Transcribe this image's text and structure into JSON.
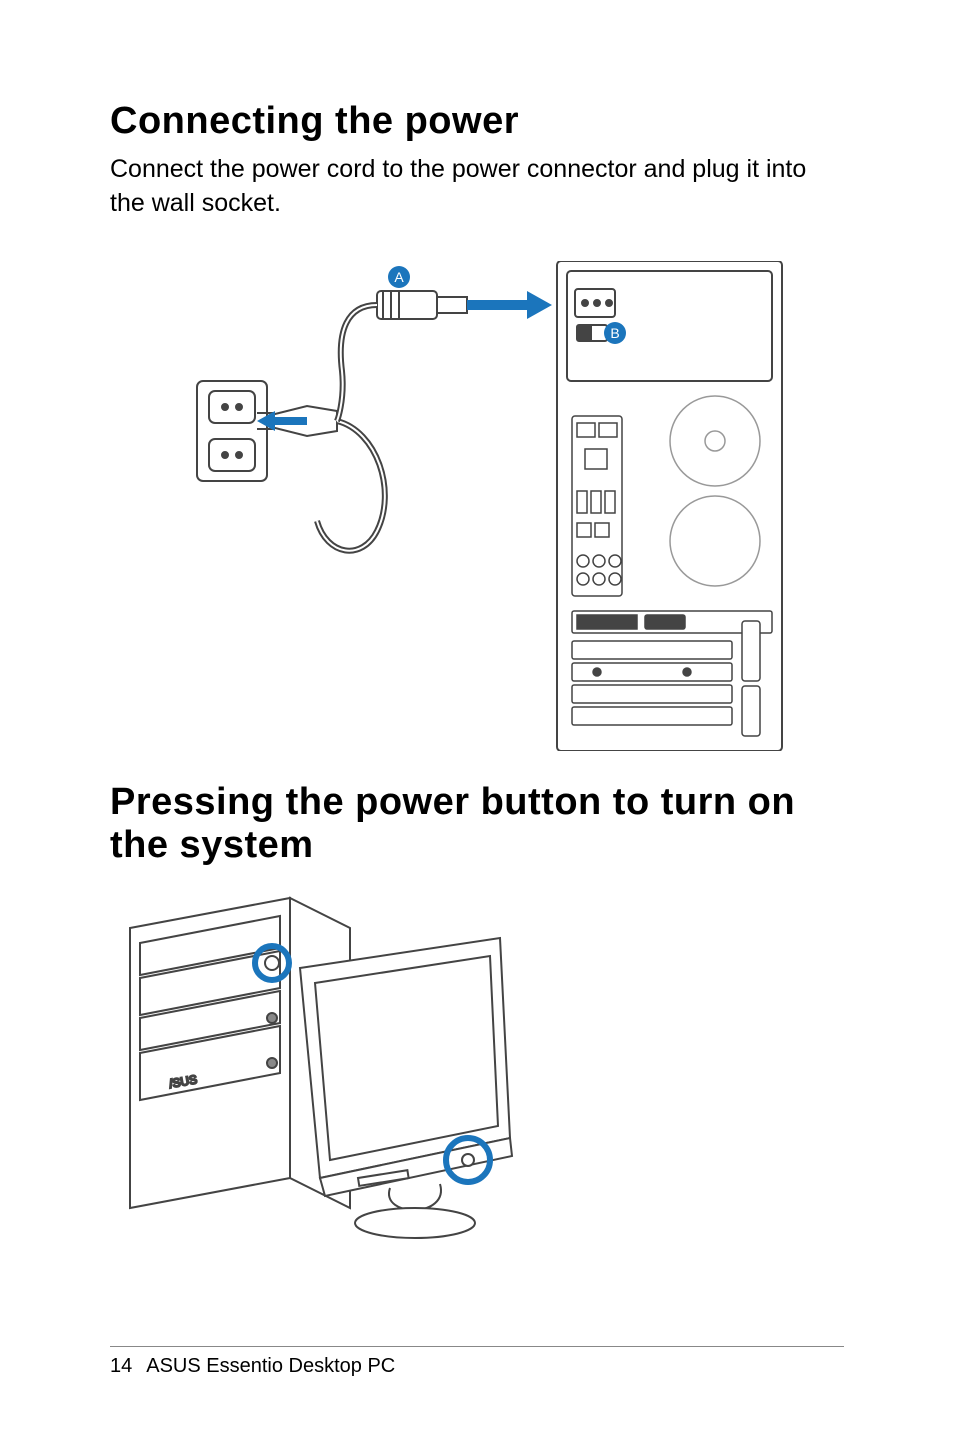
{
  "section1": {
    "heading": "Connecting the power",
    "paragraph": "Connect the power cord to the power connector and plug it into the wall socket."
  },
  "section2": {
    "heading": "Pressing the power button to turn on the system"
  },
  "figure1": {
    "labels": {
      "A": "A",
      "B": "B"
    }
  },
  "footer": {
    "page_number": "14",
    "title": "ASUS Essentio Desktop PC"
  }
}
